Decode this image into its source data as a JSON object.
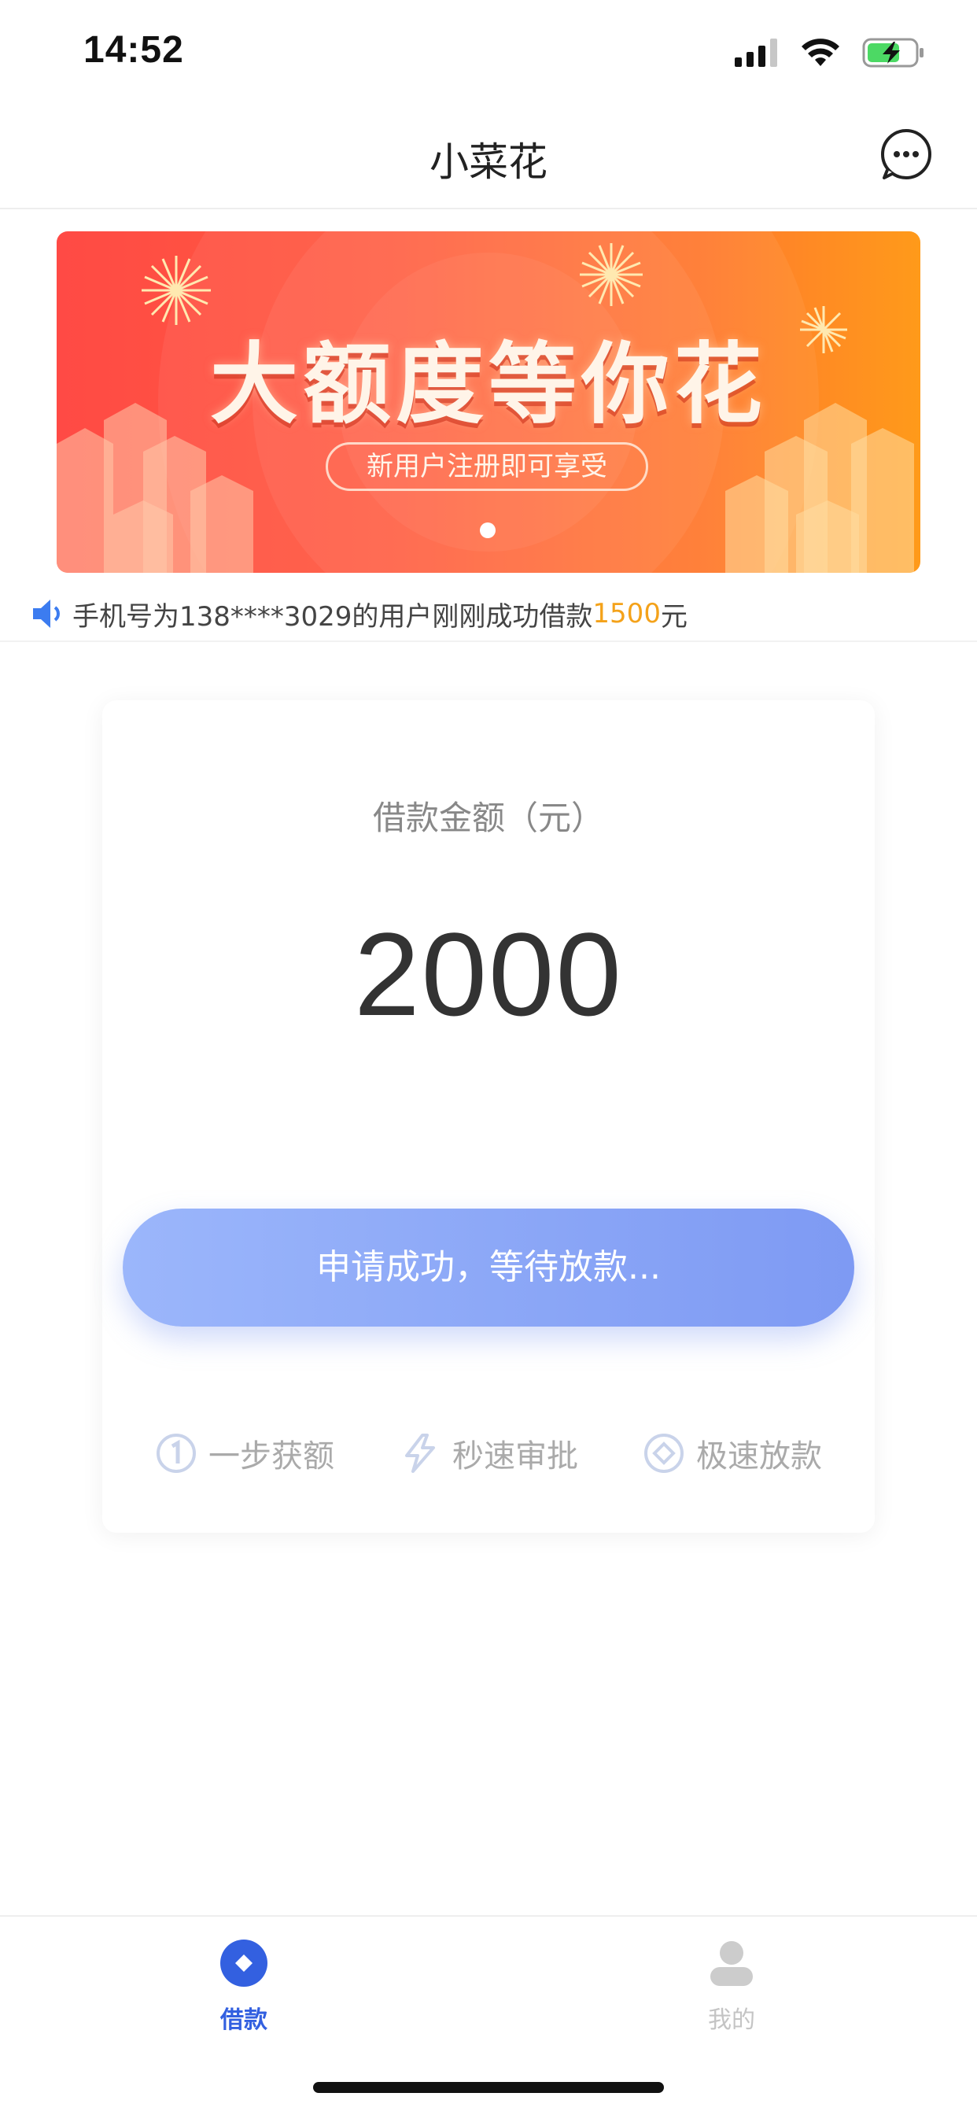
{
  "status_bar": {
    "time": "14:52"
  },
  "nav": {
    "title": "小菜花",
    "more_icon": "more-dots-icon"
  },
  "banner": {
    "title": "大额度等你花",
    "subtitle": "新用户注册即可享受",
    "colors": {
      "start": "#ff4a45",
      "end": "#ff9a1a"
    }
  },
  "notice": {
    "icon": "speaker-icon",
    "text_before": "手机号为138****3029的用户刚刚成功借款",
    "amount": "1500",
    "unit": "元",
    "highlight_color": "#f4a21a"
  },
  "loan": {
    "label": "借款金额（元）",
    "amount": "2000",
    "button_label": "申请成功，等待放款...",
    "features": [
      {
        "icon": "step-one-icon",
        "label": "一步获额"
      },
      {
        "icon": "lightning-icon",
        "label": "秒速审批"
      },
      {
        "icon": "diamond-coin-icon",
        "label": "极速放款"
      }
    ]
  },
  "tabs": [
    {
      "label": "借款",
      "active": true,
      "icon": "loan-diamond-icon"
    },
    {
      "label": "我的",
      "active": false,
      "icon": "user-icon"
    }
  ],
  "accent_color": "#3360e0"
}
